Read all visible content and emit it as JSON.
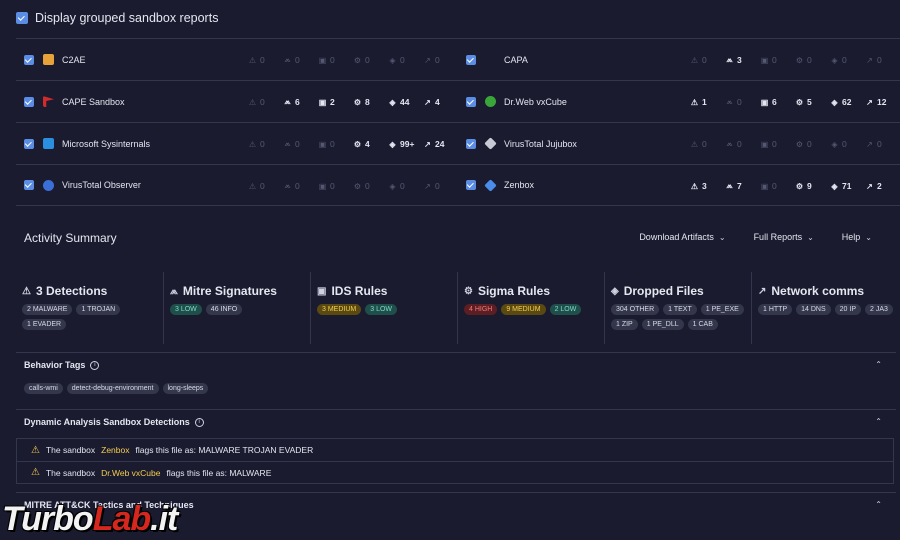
{
  "top": {
    "label": "Display grouped sandbox reports"
  },
  "colors": {
    "accent": "#5b8de4",
    "warning": "#f5cd50",
    "high": "#f07a7a",
    "low": "#7fd8c8"
  },
  "sandboxes": [
    {
      "name": "C2AE",
      "logo": "c2ae-logo",
      "stats": [
        "0",
        "0",
        "0",
        "0",
        "0",
        "0"
      ]
    },
    {
      "name": "CAPA",
      "logo": "capa-logo",
      "stats": [
        "0",
        "3",
        "0",
        "0",
        "0",
        "0"
      ]
    },
    {
      "name": "CAPE Sandbox",
      "logo": "cape-logo",
      "stats": [
        "0",
        "6",
        "2",
        "8",
        "44",
        "4"
      ]
    },
    {
      "name": "Dr.Web vxCube",
      "logo": "drweb-logo",
      "stats": [
        "1",
        "0",
        "6",
        "5",
        "62",
        "12"
      ]
    },
    {
      "name": "Microsoft Sysinternals",
      "logo": "sysinternals-logo",
      "stats": [
        "0",
        "0",
        "0",
        "4",
        "99+",
        "24"
      ]
    },
    {
      "name": "VirusTotal Jujubox",
      "logo": "jujubox-logo",
      "stats": [
        "0",
        "0",
        "0",
        "0",
        "0",
        "0"
      ]
    },
    {
      "name": "VirusTotal Observer",
      "logo": "observer-logo",
      "stats": [
        "0",
        "0",
        "0",
        "0",
        "0",
        "0"
      ]
    },
    {
      "name": "Zenbox",
      "logo": "zenbox-logo",
      "stats": [
        "3",
        "7",
        "0",
        "9",
        "71",
        "2"
      ]
    }
  ],
  "activity": {
    "title": "Activity Summary",
    "menus": [
      "Download Artifacts",
      "Full Reports",
      "Help"
    ]
  },
  "summary": [
    {
      "title": "3 Detections",
      "icon": "warning-icon",
      "tags": [
        {
          "t": "2 MALWARE",
          "k": ""
        },
        {
          "t": "1 TROJAN",
          "k": ""
        },
        {
          "t": "1 EVADER",
          "k": ""
        }
      ]
    },
    {
      "title": "Mitre Signatures",
      "icon": "mitre-icon",
      "tags": [
        {
          "t": "3 LOW",
          "k": "low"
        },
        {
          "t": "46 INFO",
          "k": ""
        }
      ]
    },
    {
      "title": "IDS Rules",
      "icon": "ids-icon",
      "tags": [
        {
          "t": "3 MEDIUM",
          "k": "med"
        },
        {
          "t": "3 LOW",
          "k": "low"
        }
      ]
    },
    {
      "title": "Sigma Rules",
      "icon": "sigma-icon",
      "tags": [
        {
          "t": "4 HIGH",
          "k": "high"
        },
        {
          "t": "9 MEDIUM",
          "k": "med"
        },
        {
          "t": "2 LOW",
          "k": "low"
        }
      ]
    },
    {
      "title": "Dropped Files",
      "icon": "files-icon",
      "tags": [
        {
          "t": "304 OTHER",
          "k": ""
        },
        {
          "t": "1 TEXT",
          "k": ""
        },
        {
          "t": "1 PE_EXE",
          "k": ""
        },
        {
          "t": "1 ZIP",
          "k": ""
        },
        {
          "t": "1 PE_DLL",
          "k": ""
        },
        {
          "t": "1 CAB",
          "k": ""
        }
      ]
    },
    {
      "title": "Network comms",
      "icon": "network-icon",
      "tags": [
        {
          "t": "1 HTTP",
          "k": ""
        },
        {
          "t": "14 DNS",
          "k": ""
        },
        {
          "t": "20 IP",
          "k": ""
        },
        {
          "t": "2 JA3",
          "k": ""
        }
      ]
    }
  ],
  "behavior": {
    "title": "Behavior Tags",
    "tags": [
      "calls-wmi",
      "detect-debug-environment",
      "long-sleeps"
    ]
  },
  "detections": {
    "title": "Dynamic Analysis Sandbox Detections",
    "lines": [
      {
        "prefix": "The sandbox",
        "sandbox": "Zenbox",
        "suffix": "flags this file as: MALWARE TROJAN EVADER"
      },
      {
        "prefix": "The sandbox",
        "sandbox": "Dr.Web vxCube",
        "suffix": "flags this file as: MALWARE"
      }
    ]
  },
  "mitre": {
    "title": "MITRE ATT&CK Tactics and Techniques"
  },
  "watermark": {
    "a": "Turbo",
    "b": "Lab",
    "c": ".it"
  }
}
